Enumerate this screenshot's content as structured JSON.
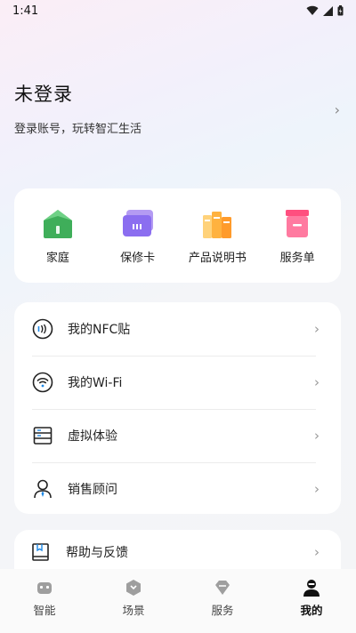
{
  "status_bar": {
    "time": "1:41"
  },
  "profile": {
    "title": "未登录",
    "subtitle": "登录账号，玩转智汇生活"
  },
  "quick_actions": [
    {
      "label": "家庭",
      "icon": "home-icon"
    },
    {
      "label": "保修卡",
      "icon": "warranty-card-icon"
    },
    {
      "label": "产品说明书",
      "icon": "manual-books-icon"
    },
    {
      "label": "服务单",
      "icon": "service-order-icon"
    }
  ],
  "menu": [
    {
      "label": "我的NFC贴",
      "icon": "nfc-icon"
    },
    {
      "label": "我的Wi-Fi",
      "icon": "wifi-icon"
    },
    {
      "label": "虚拟体验",
      "icon": "server-icon"
    },
    {
      "label": "销售顾问",
      "icon": "advisor-icon"
    }
  ],
  "help": {
    "label": "帮助与反馈",
    "icon": "book-icon"
  },
  "tabs": [
    {
      "label": "智能",
      "icon": "robot-icon",
      "active": false
    },
    {
      "label": "场景",
      "icon": "scene-icon",
      "active": false
    },
    {
      "label": "服务",
      "icon": "diamond-icon",
      "active": false
    },
    {
      "label": "我的",
      "icon": "profile-icon",
      "active": true
    }
  ]
}
